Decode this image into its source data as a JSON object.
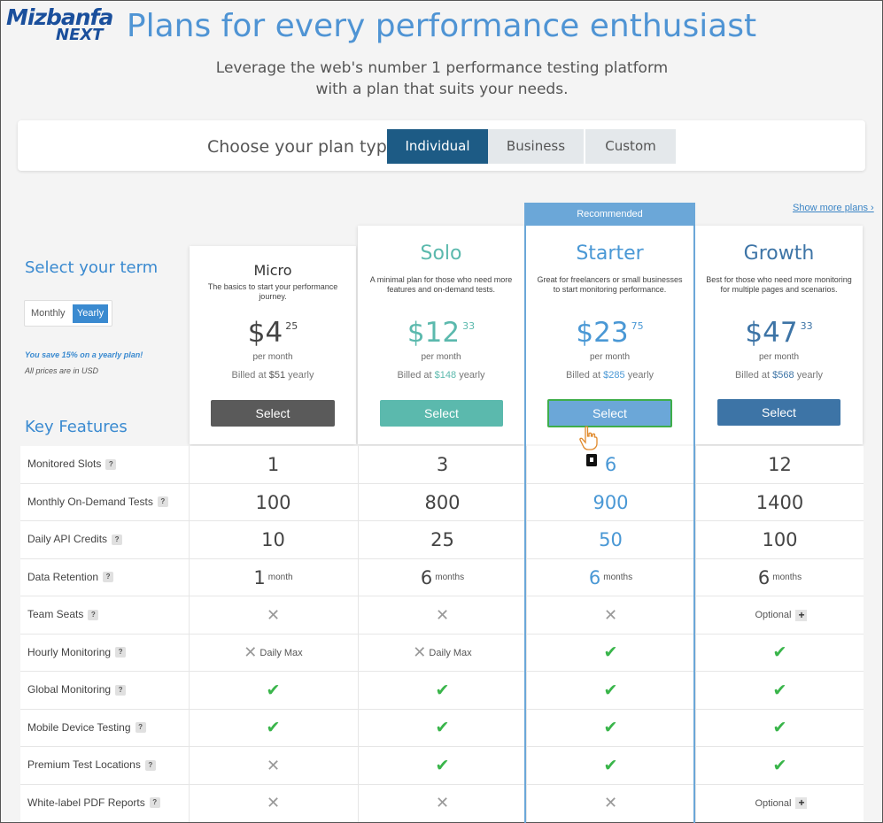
{
  "logo": {
    "line1": "Mizbanfa",
    "line2": "NEXT"
  },
  "headline": "Plans for every performance enthusiast",
  "subhead": "Leverage the web's number 1 performance testing platform with a plan that suits your needs.",
  "plan_type": {
    "label": "Choose your plan type",
    "tabs": [
      "Individual",
      "Business",
      "Custom"
    ],
    "active": "Individual"
  },
  "show_more": "Show more plans ›",
  "term": {
    "title": "Select your term",
    "monthly": "Monthly",
    "yearly": "Yearly",
    "save_note": "You save 15% on a yearly plan!",
    "usd_note": "All prices are in USD"
  },
  "key_features_title": "Key Features",
  "recommended_label": "Recommended",
  "plans": [
    {
      "name": "Micro",
      "desc": "The basics to start your performance journey.",
      "dollars": "$4",
      "cents": "25",
      "per": "per month",
      "billed_pre": "Billed at ",
      "billed_amt": "$51",
      "billed_post": " yearly",
      "select": "Select"
    },
    {
      "name": "Solo",
      "desc": "A minimal plan for those who need more features and on-demand tests.",
      "dollars": "$12",
      "cents": "33",
      "per": "per month",
      "billed_pre": "Billed at ",
      "billed_amt": "$148",
      "billed_post": " yearly",
      "select": "Select"
    },
    {
      "name": "Starter",
      "desc": "Great for freelancers or small businesses to start monitoring performance.",
      "dollars": "$23",
      "cents": "75",
      "per": "per month",
      "billed_pre": "Billed at ",
      "billed_amt": "$285",
      "billed_post": " yearly",
      "select": "Select"
    },
    {
      "name": "Growth",
      "desc": "Best for those who need more monitoring for multiple pages and scenarios.",
      "dollars": "$47",
      "cents": "33",
      "per": "per month",
      "billed_pre": "Billed at ",
      "billed_amt": "$568",
      "billed_post": " yearly",
      "select": "Select"
    }
  ],
  "features": [
    {
      "label": "Monitored Slots",
      "values": [
        "1",
        "3",
        "6",
        "12"
      ]
    },
    {
      "label": "Monthly On-Demand Tests",
      "values": [
        "100",
        "800",
        "900",
        "1400"
      ]
    },
    {
      "label": "Daily API Credits",
      "values": [
        "10",
        "25",
        "50",
        "100"
      ]
    },
    {
      "label": "Data Retention",
      "values": [
        "1",
        "6",
        "6",
        "6"
      ],
      "units": [
        "month",
        "months",
        "months",
        "months"
      ]
    },
    {
      "label": "Team Seats",
      "values": [
        "x",
        "x",
        "x",
        "Optional"
      ]
    },
    {
      "label": "Hourly Monitoring",
      "values": [
        "Daily Max",
        "Daily Max",
        "check",
        "check"
      ]
    },
    {
      "label": "Global Monitoring",
      "values": [
        "check",
        "check",
        "check",
        "check"
      ]
    },
    {
      "label": "Mobile Device Testing",
      "values": [
        "check",
        "check",
        "check",
        "check"
      ]
    },
    {
      "label": "Premium Test Locations",
      "values": [
        "x",
        "check",
        "check",
        "check"
      ]
    },
    {
      "label": "White-label PDF Reports",
      "values": [
        "x",
        "x",
        "x",
        "Optional"
      ]
    }
  ],
  "help_glyph": "?",
  "colors": {
    "accent_blue": "#4f94d4",
    "tab_active": "#1d5b85",
    "micro_btn": "#5a5a5a",
    "solo_btn": "#5bb9ad",
    "starter_btn": "#6ba7d8",
    "growth_btn": "#3d74a6",
    "check": "#39b54a"
  }
}
